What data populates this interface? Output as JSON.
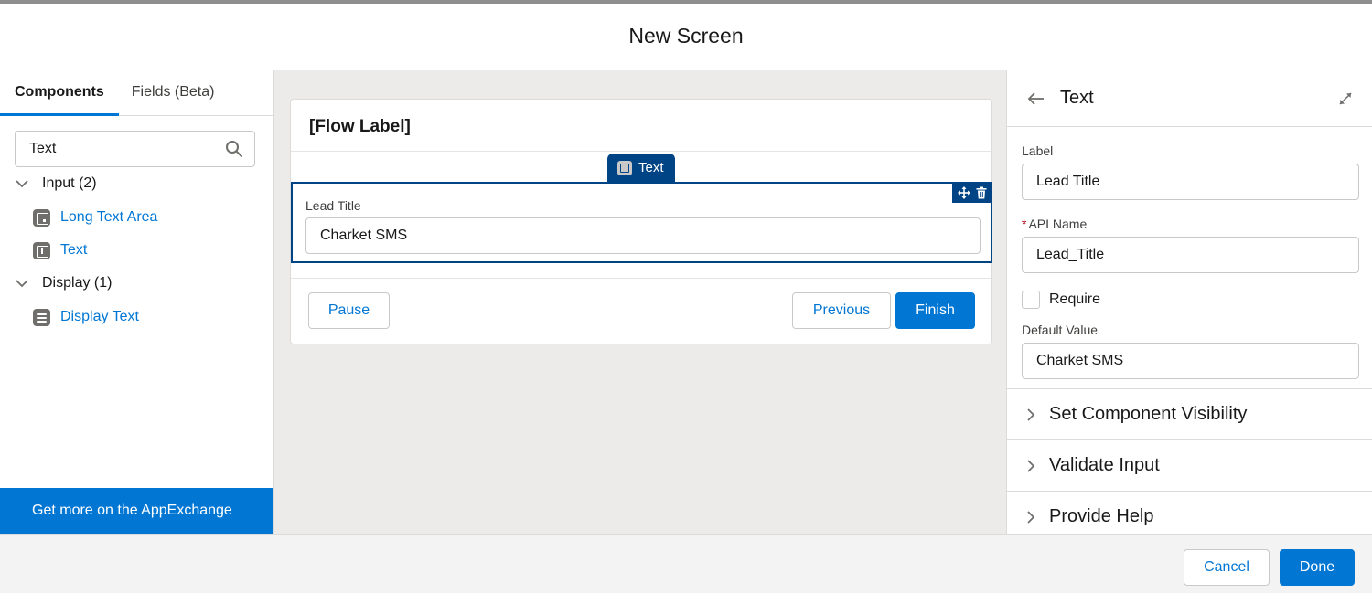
{
  "modal": {
    "title": "New Screen"
  },
  "left_panel": {
    "tabs": [
      {
        "label": "Components",
        "active": true
      },
      {
        "label": "Fields (Beta)",
        "active": false
      }
    ],
    "search": {
      "value": "Text",
      "icon": "search-icon"
    },
    "groups": [
      {
        "label": "Input (2)",
        "items": [
          {
            "label": "Long Text Area",
            "icon": "long-text-area-icon"
          },
          {
            "label": "Text",
            "icon": "text-input-icon"
          }
        ]
      },
      {
        "label": "Display (1)",
        "items": [
          {
            "label": "Display Text",
            "icon": "display-text-icon"
          }
        ]
      }
    ],
    "appexchange_label": "Get more on the AppExchange"
  },
  "canvas": {
    "flow_label": "[Flow Label]",
    "component_tag": "Text",
    "field": {
      "label": "Lead Title",
      "value": "Charket SMS"
    },
    "buttons": {
      "pause": "Pause",
      "previous": "Previous",
      "finish": "Finish"
    }
  },
  "right_panel": {
    "title": "Text",
    "label_field": {
      "label": "Label",
      "value": "Lead Title"
    },
    "api_name_field": {
      "required_mark": "*",
      "label": "API Name",
      "value": "Lead_Title"
    },
    "require": {
      "label": "Require",
      "checked": false
    },
    "default_value_field": {
      "label": "Default Value",
      "value": "Charket SMS"
    },
    "sections": [
      {
        "label": "Set Component Visibility"
      },
      {
        "label": "Validate Input"
      },
      {
        "label": "Provide Help"
      }
    ]
  },
  "footer": {
    "cancel_label": "Cancel",
    "done_label": "Done"
  },
  "colors": {
    "brand": "#0176d3",
    "selected": "#014486",
    "canvas_bg": "#ecebea"
  }
}
